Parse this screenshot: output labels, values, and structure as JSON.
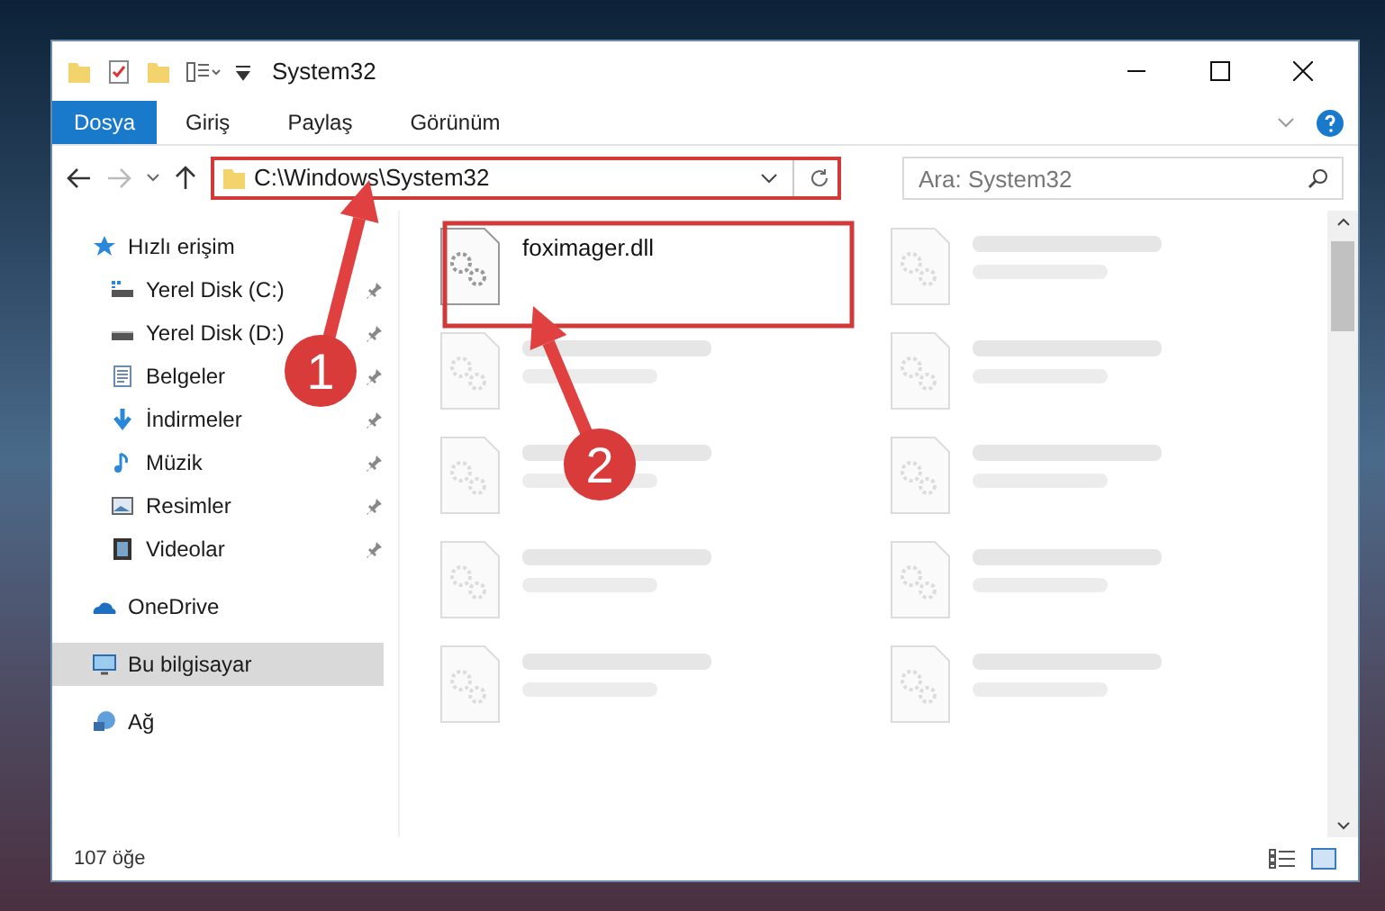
{
  "window": {
    "title": "System32"
  },
  "ribbon_tabs": [
    {
      "label": "Dosya",
      "selected": true
    },
    {
      "label": "Giriş",
      "selected": false
    },
    {
      "label": "Paylaş",
      "selected": false
    },
    {
      "label": "Görünüm",
      "selected": false
    }
  ],
  "address_bar": {
    "path": "C:\\Windows\\System32"
  },
  "search": {
    "placeholder": "Ara: System32"
  },
  "sidebar": {
    "items": [
      {
        "label": "Hızlı erişim",
        "kind": "star",
        "selected": false,
        "children": [
          {
            "label": "Yerel Disk (C:)",
            "kind": "drive-c",
            "pinned": true
          },
          {
            "label": "Yerel Disk (D:)",
            "kind": "drive",
            "pinned": true
          },
          {
            "label": "Belgeler",
            "kind": "docs",
            "pinned": true
          },
          {
            "label": "İndirmeler",
            "kind": "download",
            "pinned": true
          },
          {
            "label": "Müzik",
            "kind": "music",
            "pinned": true
          },
          {
            "label": "Resimler",
            "kind": "pictures",
            "pinned": true
          },
          {
            "label": "Videolar",
            "kind": "videos",
            "pinned": true
          }
        ]
      },
      {
        "label": "OneDrive",
        "kind": "cloud",
        "selected": false
      },
      {
        "label": "Bu bilgisayar",
        "kind": "pc",
        "selected": true
      },
      {
        "label": "Ağ",
        "kind": "network",
        "selected": false
      }
    ]
  },
  "files": [
    {
      "name": "foximager.dll",
      "blurred": false
    },
    {
      "blurred": true
    },
    {
      "blurred": true
    },
    {
      "blurred": true
    },
    {
      "blurred": true
    },
    {
      "blurred": true
    },
    {
      "blurred": true
    },
    {
      "blurred": true
    },
    {
      "blurred": true
    },
    {
      "blurred": true
    }
  ],
  "status_bar": {
    "item_count": "107 öğe"
  },
  "annotations": [
    {
      "label": "1"
    },
    {
      "label": "2"
    }
  ]
}
